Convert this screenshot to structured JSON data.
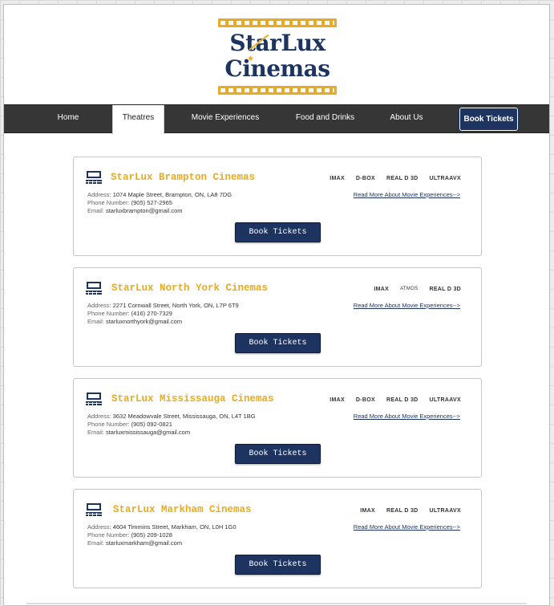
{
  "brand": {
    "line1": "StarLux",
    "line2": "Cinemas",
    "gold": "#e9ab22",
    "navy": "#1d3461"
  },
  "nav": {
    "items": [
      {
        "label": "Home",
        "active": false
      },
      {
        "label": "Theatres",
        "active": true
      },
      {
        "label": "Movie Experiences",
        "active": false
      },
      {
        "label": "Food and Drinks",
        "active": false
      },
      {
        "label": "About Us",
        "active": false
      }
    ],
    "book_label": "Book Tickets"
  },
  "labels": {
    "address": "Address:",
    "phone": "Phone Number:",
    "email": "Email:",
    "read_more": "Read More About Movie Experiences-->",
    "book": "Book Tickets"
  },
  "theatres": [
    {
      "name": "StarLux Brampton Cinemas",
      "icon": "theatre-icon",
      "address": "1074 Maple Street, Brampton, ON, LA8 7DG",
      "phone": "(905) 527-2965",
      "email": "starluxbrampton@gmail.com",
      "formats": [
        "IMAX",
        "D-BOX",
        "REAL D 3D",
        "ULTRAAVX"
      ]
    },
    {
      "name": "StarLux North York Cinemas",
      "icon": "theatre-icon",
      "address": "2271 Cornwall Street, North York, ON, L7P 6T9",
      "phone": "(416) 270-7329",
      "email": "starluxnorthyork@gmail.com",
      "formats": [
        "IMAX",
        "ATMOS",
        "REAL D 3D"
      ]
    },
    {
      "name": "StarLux Mississauga Cinemas",
      "icon": "theatre-icon",
      "address": "3632 Meadowvale Street, Mississauga, ON, L4T 1BG",
      "phone": "(905) 092-0821",
      "email": "starluxmississauga@gmail.com",
      "formats": [
        "IMAX",
        "D-BOX",
        "REAL D 3D",
        "ULTRAAVX"
      ]
    },
    {
      "name": "StarLux Markham Cinemas",
      "icon": "theatre-icon",
      "address": "4604 Timmins Street, Markham, ON, L0H 1G0",
      "phone": "(905) 209-1028",
      "email": "starluxmarkham@gmail.com",
      "formats": [
        "IMAX",
        "REAL D 3D",
        "ULTRAAVX"
      ]
    }
  ]
}
